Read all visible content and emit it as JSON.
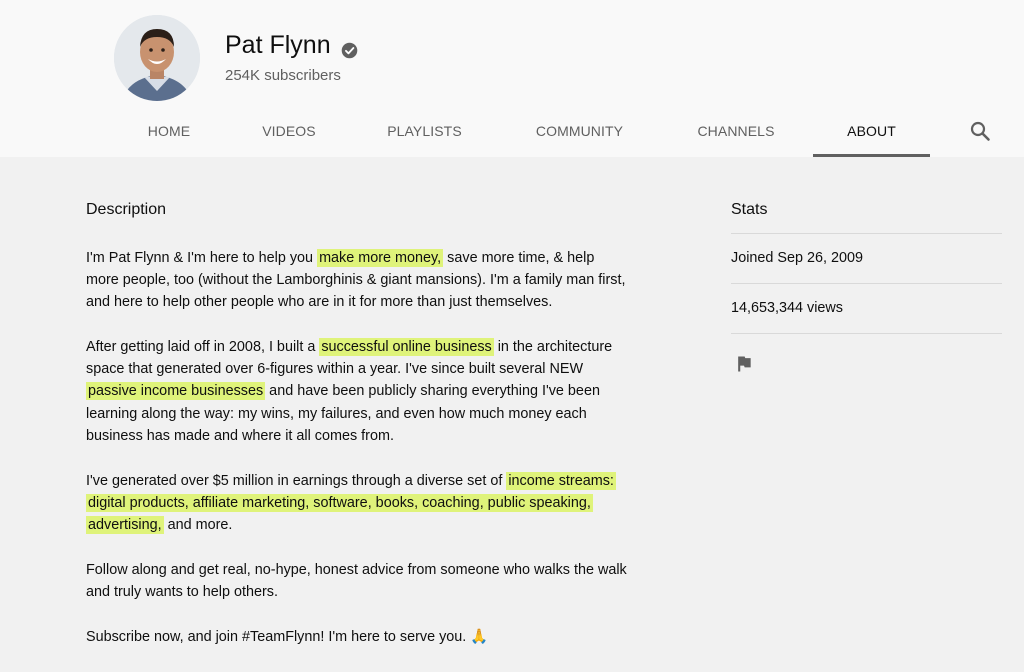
{
  "channel": {
    "name": "Pat Flynn",
    "subscribers": "254K subscribers"
  },
  "tabs": [
    {
      "label": "HOME"
    },
    {
      "label": "VIDEOS"
    },
    {
      "label": "PLAYLISTS"
    },
    {
      "label": "COMMUNITY"
    },
    {
      "label": "CHANNELS"
    },
    {
      "label": "ABOUT"
    }
  ],
  "active_tab": "ABOUT",
  "description": {
    "heading": "Description",
    "p1": {
      "a": "I'm Pat Flynn & I'm here to help you ",
      "hl1": "make more money,",
      "b": " save more time, & help more people, too (without the Lamborghinis & giant mansions). I'm a family man first, and here to help other people who are in it for more than just themselves."
    },
    "p2": {
      "a": "After getting laid off in 2008, I built a ",
      "hl1": "successful online business",
      "b": " in the architecture space that generated over 6-figures within a year. I've since built several NEW ",
      "hl2": "passive income businesses",
      "c": " and have been publicly sharing everything I've been learning along the way: my wins, my failures, and even how much money each business has made and where it all comes from."
    },
    "p3": {
      "a": "I've generated over $5 million in earnings through a diverse set of ",
      "hl1": "income streams: digital products, affiliate marketing, software, books, coaching, public speaking, advertising,",
      "b": " and more."
    },
    "p4": "Follow along and get real, no-hype, honest advice from someone who walks the walk and truly wants to help others.",
    "p5": "Subscribe now, and join #TeamFlynn! I'm here to serve you. 🙏"
  },
  "stats": {
    "heading": "Stats",
    "joined": "Joined Sep 26, 2009",
    "views": "14,653,344 views"
  },
  "icons": {
    "verified": "verified-check-icon",
    "search": "search-icon",
    "flag": "flag-icon"
  },
  "colors": {
    "highlight": "#dff37a",
    "header_bg": "#f9f9f9",
    "page_bg": "#f1f1f1"
  }
}
